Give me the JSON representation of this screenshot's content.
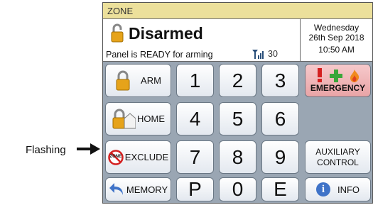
{
  "header": {
    "zone_label": "ZONE"
  },
  "status": {
    "title": "Disarmed",
    "message": "Panel is READY for arming",
    "signal_value": "30"
  },
  "datetime": {
    "weekday": "Wednesday",
    "date": "26th Sep 2018",
    "time": "10:50 AM"
  },
  "buttons": {
    "arm": "ARM",
    "home": "HOME",
    "exclude": "EXCLUDE",
    "exclude_icon_text": "ZONE",
    "memory": "MEMORY",
    "emergency": "EMERGENCY",
    "auxiliary_line1": "AUXILIARY",
    "auxiliary_line2": "CONTROL",
    "info": "INFO"
  },
  "keypad": [
    "1",
    "2",
    "3",
    "4",
    "5",
    "6",
    "7",
    "8",
    "9",
    "P",
    "0",
    "E"
  ],
  "annotation": {
    "flashing": "Flashing"
  },
  "colors": {
    "zone_bar": "#ece09b",
    "panel_bg": "#9aa6b3",
    "emergency_bg": "#e9a4a6",
    "info_blue": "#3f73c8"
  }
}
